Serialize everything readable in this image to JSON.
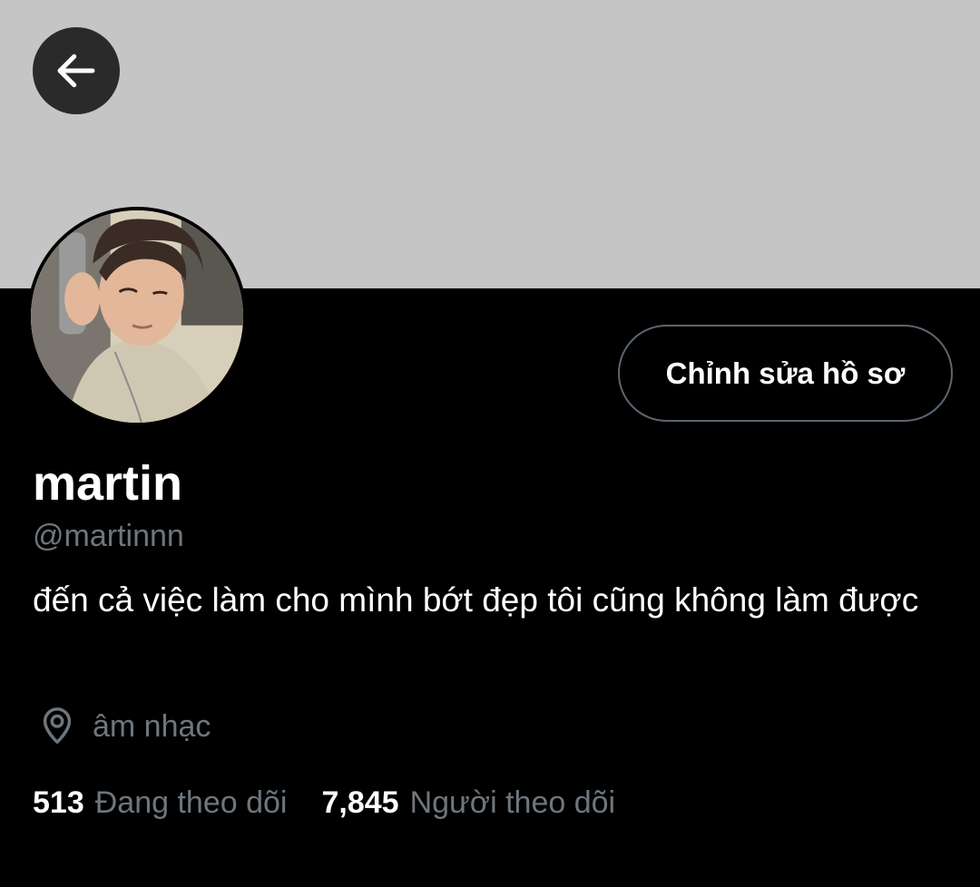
{
  "header": {
    "back_icon": "arrow-left-icon",
    "banner_color": "#c5c5c5"
  },
  "profile": {
    "avatar_icon": "profile-photo",
    "edit_button_label": "Chỉnh sửa hồ sơ",
    "display_name": "martin",
    "handle": "@martinnn",
    "bio": "đến cả việc làm cho mình bớt đẹp tôi cũng không làm được",
    "location_icon": "location-pin-icon",
    "location": "âm nhạc"
  },
  "stats": {
    "following_count": "513",
    "following_label": "Đang theo dõi",
    "followers_count": "7,845",
    "followers_label": "Người theo dõi"
  },
  "colors": {
    "background": "#000000",
    "text_primary": "#ffffff",
    "text_secondary": "#6e767d",
    "button_border": "#5b6670"
  }
}
